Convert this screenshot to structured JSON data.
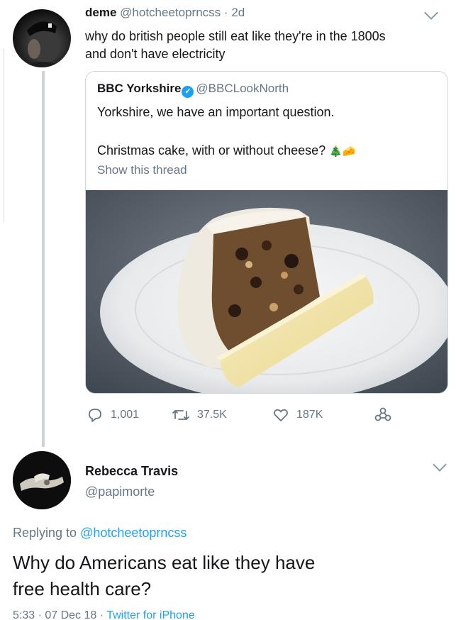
{
  "tweet": {
    "name": "deme",
    "handle": "@hotcheetoprncss",
    "separator": "·",
    "age": "2d",
    "text_line1": "why do british people still eat like they're in the 1800s",
    "text_line2": "and don't have electricity"
  },
  "quote": {
    "name": "BBC Yorkshire",
    "handle": "@BBCLookNorth",
    "line1": "Yorkshire, we have an important question.",
    "line2": "Christmas cake, with or without cheese?",
    "emojis": "🎄🧀",
    "show_thread": "Show this thread"
  },
  "actions": {
    "replies": "1,001",
    "retweets": "37.5K",
    "likes": "187K"
  },
  "reply": {
    "name": "Rebecca Travis",
    "handle": "@papimorte",
    "replying_prefix": "Replying to",
    "replying_to": "@hotcheetoprncss",
    "text_line1": "Why do Americans eat like they have",
    "text_line2": "free health care?",
    "time": "5:33 · 07 Dec 18 ·",
    "source": "Twitter for iPhone"
  },
  "colors": {
    "link": "#1da1f2",
    "muted": "#657786",
    "text": "#14171a"
  }
}
